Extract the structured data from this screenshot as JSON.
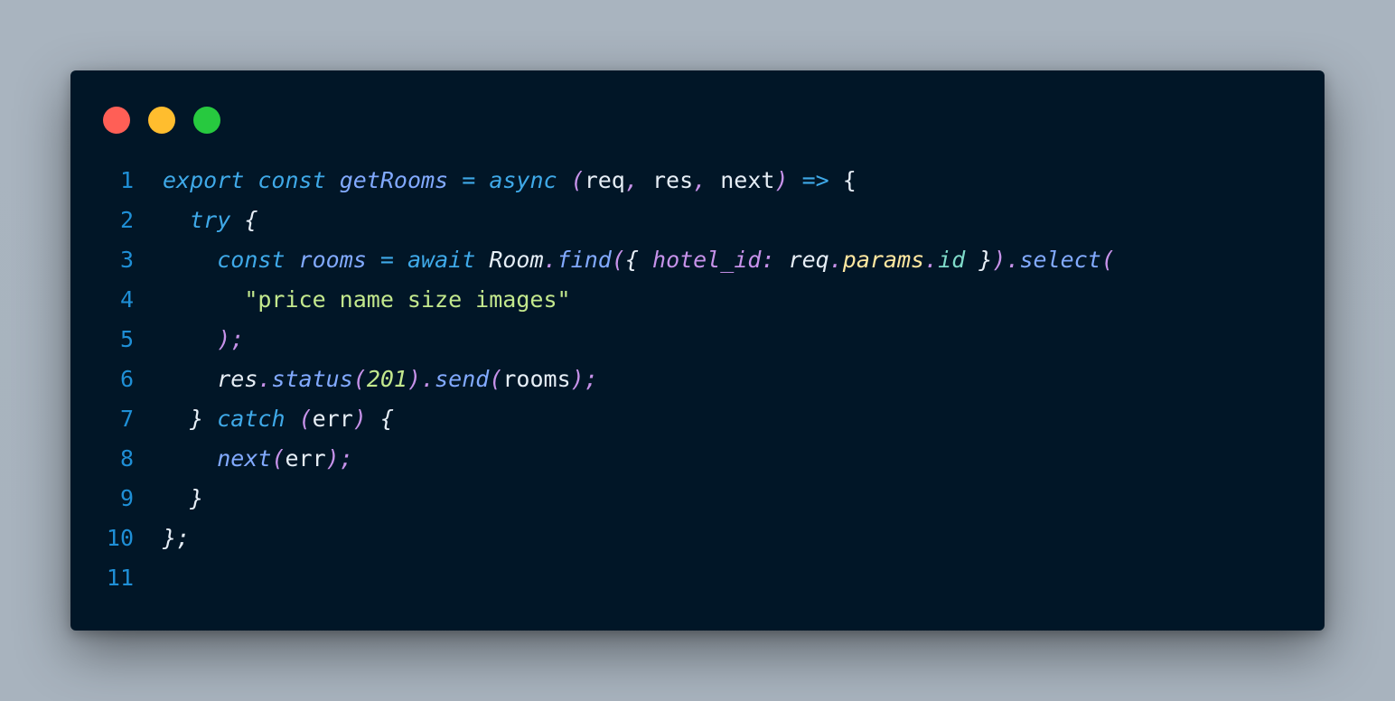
{
  "window": {
    "background": "#011627",
    "traffic_lights": [
      {
        "name": "close",
        "color": "#ff5f56"
      },
      {
        "name": "minimize",
        "color": "#ffbd2e"
      },
      {
        "name": "maximize",
        "color": "#27c93f"
      }
    ]
  },
  "colors": {
    "keyword": "#3fa9e8",
    "function": "#82aaff",
    "property": "#c792ea",
    "punct": "#c792ea",
    "plain": "#e6eef6",
    "string": "#c3e88d",
    "number": "#c3e88d",
    "yellow": "#ffe7a0",
    "teal": "#7fdbca",
    "line_number": "#1f8fd6"
  },
  "code": {
    "lines": [
      {
        "number": "1",
        "tokens": [
          {
            "t": "export",
            "c": "keyword",
            "i": true
          },
          {
            "t": " ",
            "c": "plain",
            "i": false
          },
          {
            "t": "const",
            "c": "keyword",
            "i": true
          },
          {
            "t": " ",
            "c": "plain",
            "i": false
          },
          {
            "t": "getRooms",
            "c": "function",
            "i": true
          },
          {
            "t": " ",
            "c": "plain",
            "i": false
          },
          {
            "t": "=",
            "c": "keyword",
            "i": false
          },
          {
            "t": " ",
            "c": "plain",
            "i": false
          },
          {
            "t": "async",
            "c": "keyword",
            "i": true
          },
          {
            "t": " ",
            "c": "plain",
            "i": false
          },
          {
            "t": "(",
            "c": "punct",
            "i": true
          },
          {
            "t": "req",
            "c": "plain",
            "i": false
          },
          {
            "t": ",",
            "c": "punct",
            "i": true
          },
          {
            "t": " res",
            "c": "plain",
            "i": false
          },
          {
            "t": ",",
            "c": "punct",
            "i": true
          },
          {
            "t": " next",
            "c": "plain",
            "i": false
          },
          {
            "t": ")",
            "c": "punct",
            "i": true
          },
          {
            "t": " ",
            "c": "plain",
            "i": false
          },
          {
            "t": "=>",
            "c": "keyword",
            "i": false
          },
          {
            "t": " {",
            "c": "plain",
            "i": false
          }
        ]
      },
      {
        "number": "2",
        "tokens": [
          {
            "t": "  ",
            "c": "plain",
            "i": false
          },
          {
            "t": "try",
            "c": "keyword",
            "i": true
          },
          {
            "t": " {",
            "c": "plain",
            "i": true
          }
        ]
      },
      {
        "number": "3",
        "tokens": [
          {
            "t": "    ",
            "c": "plain",
            "i": false
          },
          {
            "t": "const",
            "c": "keyword",
            "i": true
          },
          {
            "t": " ",
            "c": "plain",
            "i": false
          },
          {
            "t": "rooms",
            "c": "function",
            "i": true
          },
          {
            "t": " ",
            "c": "plain",
            "i": false
          },
          {
            "t": "=",
            "c": "keyword",
            "i": false
          },
          {
            "t": " ",
            "c": "plain",
            "i": false
          },
          {
            "t": "await",
            "c": "keyword",
            "i": true
          },
          {
            "t": " ",
            "c": "plain",
            "i": false
          },
          {
            "t": "Room",
            "c": "plain",
            "i": true
          },
          {
            "t": ".",
            "c": "property",
            "i": true
          },
          {
            "t": "find",
            "c": "function",
            "i": true
          },
          {
            "t": "(",
            "c": "punct",
            "i": true
          },
          {
            "t": "{",
            "c": "plain",
            "i": true
          },
          {
            "t": " ",
            "c": "plain",
            "i": false
          },
          {
            "t": "hotel_id",
            "c": "property",
            "i": true
          },
          {
            "t": ":",
            "c": "property",
            "i": true
          },
          {
            "t": " ",
            "c": "plain",
            "i": false
          },
          {
            "t": "req",
            "c": "plain",
            "i": true
          },
          {
            "t": ".",
            "c": "property",
            "i": true
          },
          {
            "t": "params",
            "c": "yellow",
            "i": true
          },
          {
            "t": ".",
            "c": "property",
            "i": true
          },
          {
            "t": "id",
            "c": "teal",
            "i": true
          },
          {
            "t": " }",
            "c": "plain",
            "i": true
          },
          {
            "t": ")",
            "c": "punct",
            "i": true
          },
          {
            "t": ".",
            "c": "property",
            "i": true
          },
          {
            "t": "select",
            "c": "function",
            "i": true
          },
          {
            "t": "(",
            "c": "punct",
            "i": true
          }
        ]
      },
      {
        "number": "4",
        "tokens": [
          {
            "t": "      ",
            "c": "plain",
            "i": false
          },
          {
            "t": "\"price name size images\"",
            "c": "string",
            "i": false
          }
        ]
      },
      {
        "number": "5",
        "tokens": [
          {
            "t": "    ",
            "c": "plain",
            "i": false
          },
          {
            "t": ");",
            "c": "punct",
            "i": true
          }
        ]
      },
      {
        "number": "6",
        "tokens": [
          {
            "t": "    ",
            "c": "plain",
            "i": false
          },
          {
            "t": "res",
            "c": "plain",
            "i": true
          },
          {
            "t": ".",
            "c": "property",
            "i": true
          },
          {
            "t": "status",
            "c": "function",
            "i": true
          },
          {
            "t": "(",
            "c": "punct",
            "i": true
          },
          {
            "t": "201",
            "c": "number",
            "i": true
          },
          {
            "t": ")",
            "c": "punct",
            "i": true
          },
          {
            "t": ".",
            "c": "property",
            "i": true
          },
          {
            "t": "send",
            "c": "function",
            "i": true
          },
          {
            "t": "(",
            "c": "punct",
            "i": true
          },
          {
            "t": "rooms",
            "c": "plain",
            "i": false
          },
          {
            "t": ");",
            "c": "punct",
            "i": true
          }
        ]
      },
      {
        "number": "7",
        "tokens": [
          {
            "t": "  ",
            "c": "plain",
            "i": false
          },
          {
            "t": "}",
            "c": "plain",
            "i": true
          },
          {
            "t": " ",
            "c": "plain",
            "i": false
          },
          {
            "t": "catch",
            "c": "keyword",
            "i": true
          },
          {
            "t": " ",
            "c": "plain",
            "i": false
          },
          {
            "t": "(",
            "c": "punct",
            "i": true
          },
          {
            "t": "err",
            "c": "plain",
            "i": false
          },
          {
            "t": ")",
            "c": "punct",
            "i": true
          },
          {
            "t": " {",
            "c": "plain",
            "i": true
          }
        ]
      },
      {
        "number": "8",
        "tokens": [
          {
            "t": "    ",
            "c": "plain",
            "i": false
          },
          {
            "t": "next",
            "c": "function",
            "i": true
          },
          {
            "t": "(",
            "c": "punct",
            "i": true
          },
          {
            "t": "err",
            "c": "plain",
            "i": false
          },
          {
            "t": ");",
            "c": "punct",
            "i": true
          }
        ]
      },
      {
        "number": "9",
        "tokens": [
          {
            "t": "  ",
            "c": "plain",
            "i": false
          },
          {
            "t": "}",
            "c": "plain",
            "i": true
          }
        ]
      },
      {
        "number": "10",
        "tokens": [
          {
            "t": "};",
            "c": "plain",
            "i": true
          }
        ]
      },
      {
        "number": "11",
        "tokens": []
      }
    ]
  }
}
